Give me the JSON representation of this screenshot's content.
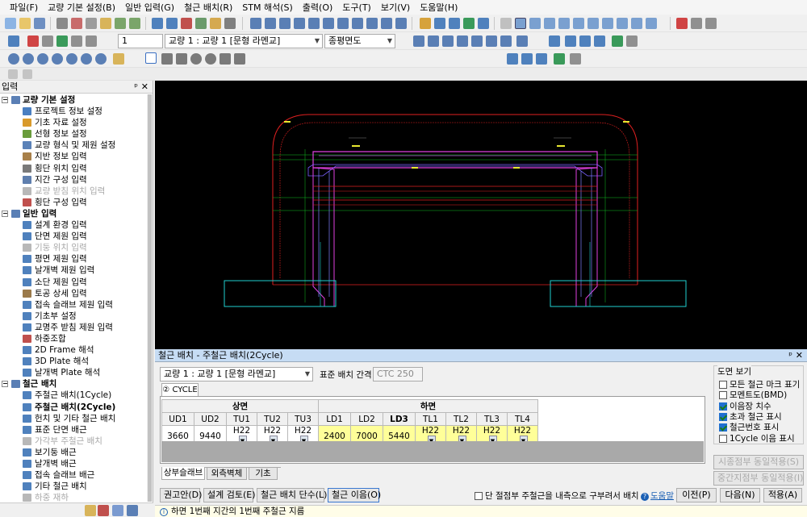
{
  "menu": [
    "파일(F)",
    "교량 기본 설정(B)",
    "일반 입력(G)",
    "철근 배치(R)",
    "STM 해석(S)",
    "출력(O)",
    "도구(T)",
    "보기(V)",
    "도움말(H)"
  ],
  "toolbar2": {
    "number_field": "1",
    "bridge_combo": "교량 1 : 교량 1 [문형 라멘교]",
    "view_combo": "종평면도"
  },
  "left_panel": {
    "title": "입력",
    "pin": "ᵖ",
    "close": "✕",
    "groups": [
      {
        "label": "교량 기본 설정",
        "items": [
          {
            "label": "프로젝트 정보 설정",
            "state": "normal",
            "icon": "document-icon",
            "color": "#4a7fc1"
          },
          {
            "label": "기초 자료 설정",
            "state": "normal",
            "icon": "edit-icon",
            "color": "#d99a2b"
          },
          {
            "label": "선형 정보 설정",
            "state": "normal",
            "icon": "curve-icon",
            "color": "#6a9c3c"
          },
          {
            "label": "교량 형식 및 제원 설정",
            "state": "normal",
            "icon": "bridge-icon",
            "color": "#5b82b8"
          },
          {
            "label": "지반 정보 입력",
            "state": "normal",
            "icon": "ground-icon",
            "color": "#a8804a"
          },
          {
            "label": "횡단 위치 입력",
            "state": "normal",
            "icon": "cross-icon",
            "color": "#7a7a7a"
          },
          {
            "label": "지간 구성 입력",
            "state": "normal",
            "icon": "span-icon",
            "color": "#5f7fae"
          },
          {
            "label": "교량 받침 위치 입력",
            "state": "disabled",
            "icon": "bearing-icon",
            "color": "#b8b8b8"
          },
          {
            "label": "횡단 구성 입력",
            "state": "normal",
            "icon": "section-icon",
            "color": "#c0504d"
          }
        ]
      },
      {
        "label": "일반 입력",
        "items": [
          {
            "label": "설계 환경 입력",
            "state": "normal",
            "icon": "settings-icon",
            "color": "#4f81bd"
          },
          {
            "label": "단면 제원 입력",
            "state": "normal",
            "icon": "section-icon",
            "color": "#4f81bd"
          },
          {
            "label": "기둥 위치 입력",
            "state": "disabled",
            "icon": "column-icon",
            "color": "#b8b8b8"
          },
          {
            "label": "평면 제원 입력",
            "state": "normal",
            "icon": "plan-icon",
            "color": "#4f81bd"
          },
          {
            "label": "날개벽 제원 입력",
            "state": "normal",
            "icon": "wingwall-icon",
            "color": "#4f81bd"
          },
          {
            "label": "소단 제원 입력",
            "state": "normal",
            "icon": "berm-icon",
            "color": "#4f81bd"
          },
          {
            "label": "토공 상세 입력",
            "state": "normal",
            "icon": "earthwork-icon",
            "color": "#9b7a4a"
          },
          {
            "label": "접속 슬래브 제원 입력",
            "state": "normal",
            "icon": "slab-icon",
            "color": "#4f81bd"
          },
          {
            "label": "기초부 설정",
            "state": "normal",
            "icon": "footing-icon",
            "color": "#4f81bd"
          },
          {
            "label": "교명주 받침 제원 입력",
            "state": "normal",
            "icon": "pillar-icon",
            "color": "#4f81bd"
          },
          {
            "label": "하중조합",
            "state": "normal",
            "icon": "load-icon",
            "color": "#c0504d"
          },
          {
            "label": "2D Frame 해석",
            "state": "normal",
            "icon": "frame-icon",
            "color": "#4f81bd"
          },
          {
            "label": "3D Plate 해석",
            "state": "normal",
            "icon": "plate-icon",
            "color": "#4f81bd"
          },
          {
            "label": "날개벽 Plate 해석",
            "state": "normal",
            "icon": "plate-icon",
            "color": "#4f81bd"
          }
        ]
      },
      {
        "label": "철근 배치",
        "items": [
          {
            "label": "주철근 배치(1Cycle)",
            "state": "normal",
            "icon": "rebar-icon",
            "color": "#4f81bd"
          },
          {
            "label": "주철근 배치(2Cycle)",
            "state": "selected",
            "icon": "rebar-icon",
            "color": "#4f81bd"
          },
          {
            "label": "헌치 및 기타 철근 배치",
            "state": "normal",
            "icon": "rebar-icon",
            "color": "#4f81bd"
          },
          {
            "label": "표준 단면 배근",
            "state": "normal",
            "icon": "rebar-icon",
            "color": "#4f81bd"
          },
          {
            "label": "가각부 주철근 배치",
            "state": "disabled",
            "icon": "rebar-icon",
            "color": "#b8b8b8"
          },
          {
            "label": "보기둥 배근",
            "state": "normal",
            "icon": "rebar-icon",
            "color": "#4f81bd"
          },
          {
            "label": "날개벽 배근",
            "state": "normal",
            "icon": "rebar-icon",
            "color": "#4f81bd"
          },
          {
            "label": "접속 슬래브 배근",
            "state": "normal",
            "icon": "rebar-icon",
            "color": "#4f81bd"
          },
          {
            "label": "기타 철근 배치",
            "state": "normal",
            "icon": "rebar-icon",
            "color": "#4f81bd"
          },
          {
            "label": "하중 재하",
            "state": "disabled",
            "icon": "load-icon",
            "color": "#b8b8b8"
          }
        ]
      }
    ]
  },
  "dialog": {
    "title": "철근 배치 - 주철근 배치(2Cycle)",
    "pin": "ᵖ",
    "close": "✕",
    "bridge_combo": "교량 1 : 교량 1 [문형 라멘교]",
    "std_label": "표준 배치 간격",
    "std_value": "CTC 250",
    "cycle_tab": "② CYCLE",
    "group_upper": "상면",
    "group_lower": "하면",
    "columns": [
      "UD1",
      "UD2",
      "TU1",
      "TU2",
      "TU3",
      "LD1",
      "LD2",
      "LD3",
      "TL1",
      "TL2",
      "TL3",
      "TL4"
    ],
    "row1": [
      "3660",
      "9440",
      "H22",
      "H22",
      "H22",
      "2400",
      "7000",
      "5440",
      "H22",
      "H22",
      "H22",
      "H22"
    ],
    "checks": [
      false,
      false,
      true,
      false,
      true,
      false,
      false,
      false,
      false,
      true,
      true,
      false
    ],
    "subtabs": [
      "상부슬래브",
      "외측벽체",
      "기초"
    ],
    "view_group_title": "도면 보기",
    "view_options": [
      {
        "label": "모든 철근 마크 표기",
        "checked": false
      },
      {
        "label": "모멘트도(BMD)",
        "checked": false
      },
      {
        "label": "이음장 치수",
        "checked": true
      },
      {
        "label": "초과 철근 표시",
        "checked": true
      },
      {
        "label": "철근번호 표시",
        "checked": true
      },
      {
        "label": "1Cycle 이음 표시",
        "checked": false
      }
    ],
    "side_buttons": [
      "시종점부 동일적용(S)",
      "중간지점부 동일적용(I)"
    ],
    "bottom_buttons": [
      "권고안(D)",
      "설계 검토(E)",
      "철근 배치 단수(L)",
      "철근 이음(O)"
    ],
    "bottom_check": "단 절점부 주철근을 내측으로 구부려서 배치",
    "help": "도움말",
    "nav_buttons": [
      "이전(P)",
      "다음(N)",
      "적용(A)"
    ]
  },
  "status": "하면 1번째 지간의 1번째 주철근 지름"
}
